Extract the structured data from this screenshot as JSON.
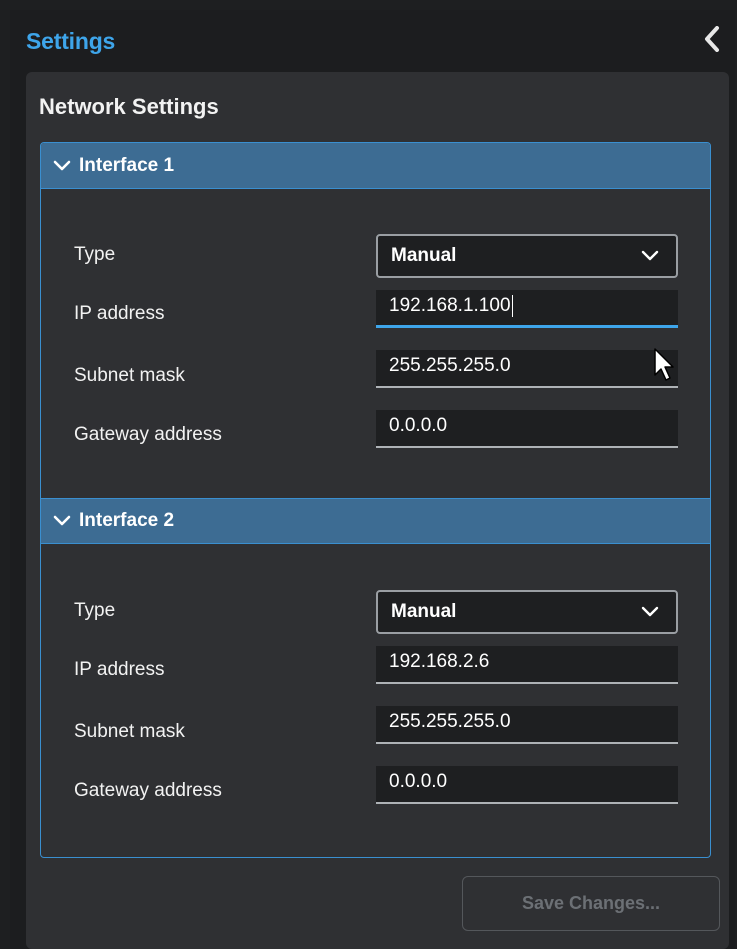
{
  "header": {
    "title": "Settings",
    "collapse_icon": "chevron-left-icon"
  },
  "panel": {
    "heading": "Network Settings"
  },
  "interfaces": [
    {
      "title": "Interface 1",
      "expanded": true,
      "type_label": "Type",
      "type_value": "Manual",
      "ip_label": "IP address",
      "ip_value": "192.168.1.100",
      "subnet_label": "Subnet mask",
      "subnet_value": "255.255.255.0",
      "gateway_label": "Gateway address",
      "gateway_value": "0.0.0.0"
    },
    {
      "title": "Interface 2",
      "expanded": true,
      "type_label": "Type",
      "type_value": "Manual",
      "ip_label": "IP address",
      "ip_value": "192.168.2.6",
      "subnet_label": "Subnet mask",
      "subnet_value": "255.255.255.0",
      "gateway_label": "Gateway address",
      "gateway_value": "0.0.0.0"
    }
  ],
  "footer": {
    "save_label": "Save Changes...",
    "save_enabled": false
  },
  "colors": {
    "accent": "#3ea5ea",
    "section_header": "#3d6c93",
    "panel_bg": "#2f3033",
    "background": "#1c1d1f"
  }
}
